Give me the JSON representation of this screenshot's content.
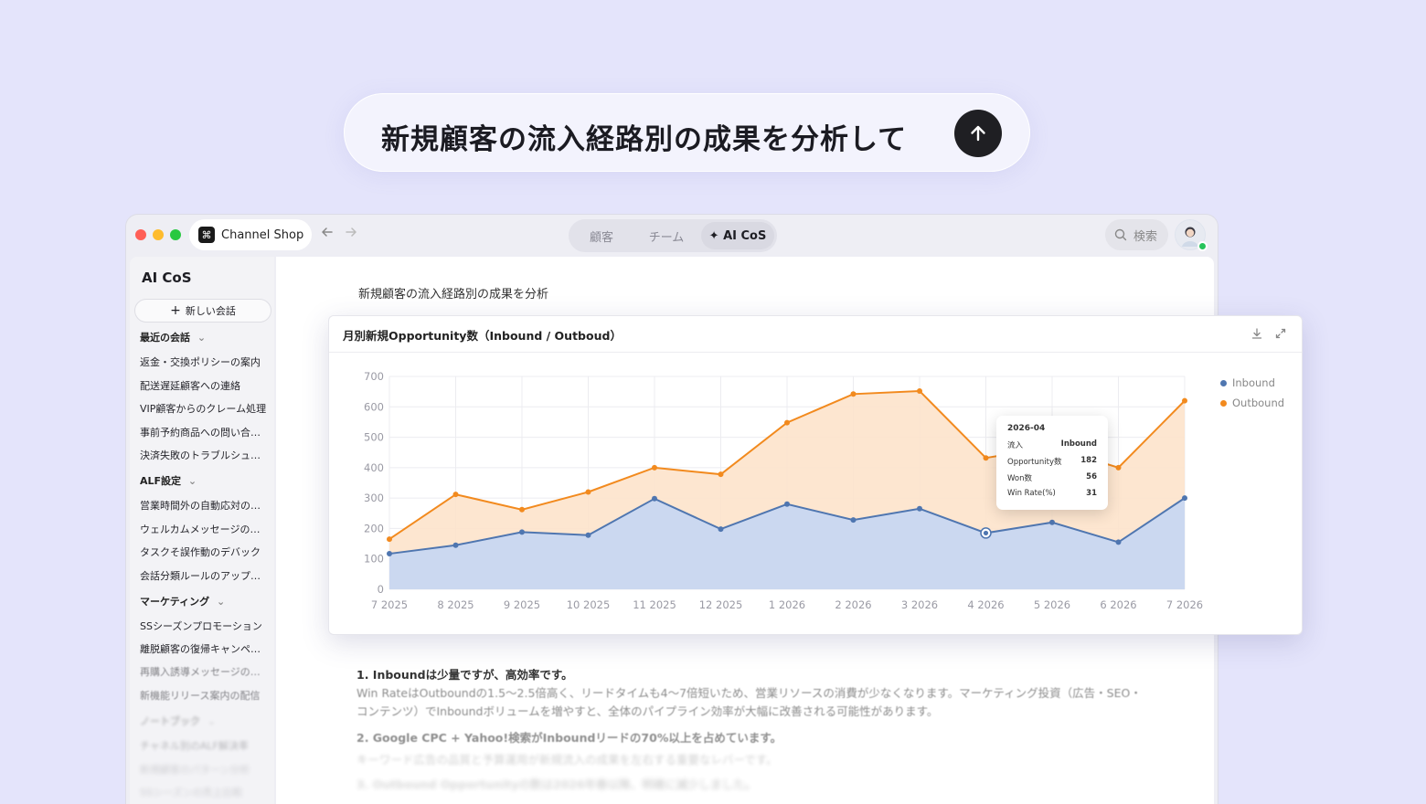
{
  "prompt": {
    "text": "新規顧客の流入経路別の成果を分析して",
    "send_icon": "arrow-up-icon"
  },
  "window": {
    "app_name": "Channel Shop",
    "tabs": [
      {
        "label": "顧客",
        "active": false
      },
      {
        "label": "チーム",
        "active": false
      },
      {
        "label": "✦ AI CoS",
        "active": true
      }
    ],
    "search_label": "検索"
  },
  "sidebar": {
    "title": "AI CoS",
    "new_chat": "新しい会話",
    "sections": [
      {
        "heading": "最近の会話",
        "items": [
          "返金・交換ポリシーの案内",
          "配送遅延顧客への連絡",
          "VIP顧客からのクレーム処理",
          "事前予約商品への問い合わせ",
          "決済失敗のトラブルシューティング"
        ]
      },
      {
        "heading": "ALF設定",
        "items": [
          "営業時間外の自動応対の設定",
          "ウェルカムメッセージの設定",
          "タスクそ誤作動のデバック",
          "会話分類ルールのアップデート"
        ]
      },
      {
        "heading": "マーケティング",
        "items": [
          "SSシーズンプロモーション",
          "離脱顧客の復帰キャンペーン",
          "再購入誘導メッセージの作成",
          "新機能リリース案内の配信"
        ]
      },
      {
        "heading": "ノートブック",
        "items": [
          "チャネル別のALF解決率",
          "新規顧客のパターン分析",
          "SSシーズンの売上比較"
        ]
      }
    ]
  },
  "main": {
    "query": "新規顧客の流入経路別の成果を分析",
    "answer": {
      "p1_head": "1. Inboundは少量ですが、高効率です。",
      "p1_body": "Win RateはOutboundの1.5〜2.5倍高く、リードタイムも4〜7倍短いため、営業リソースの消費が少なくなります。マーケティング投資（広告・SEO・コンテンツ）でInboundボリュームを増やすと、全体のパイプライン効率が大幅に改善される可能性があります。",
      "p2_head": "2. Google CPC + Yahoo!検索がInboundリードの70%以上を占めています。",
      "p2_body": "キーワード広告の品質と予算運用が新規流入の成果を左右する重要なレバーです。",
      "p3_head": "3. Outbound Opportunityの数は2026年春以降、明確に減少しました。"
    }
  },
  "chart": {
    "title": "月別新規Opportunity数（Inbound / Outboud）",
    "tools": [
      "download-icon",
      "expand-icon"
    ],
    "tooltip": {
      "date": "2026-04",
      "rows": [
        {
          "label": "流入",
          "value": "Inbound"
        },
        {
          "label": "Opportunity数",
          "value": "182"
        },
        {
          "label": "Won数",
          "value": "56"
        },
        {
          "label": "Win Rate(%)",
          "value": "31"
        }
      ]
    }
  },
  "chart_data": {
    "type": "area",
    "title": "月別新規Opportunity数（Inbound / Outboud）",
    "categories": [
      "7 2025",
      "8 2025",
      "9 2025",
      "10 2025",
      "11 2025",
      "12 2025",
      "1 2026",
      "2 2026",
      "3 2026",
      "4 2026",
      "5 2026",
      "6 2026",
      "7 2026"
    ],
    "series": [
      {
        "name": "Inbound",
        "color": "#4f76b0",
        "fill": "#c5d6f3",
        "values": [
          117,
          145,
          188,
          178,
          298,
          198,
          280,
          228,
          265,
          185,
          220,
          155,
          300
        ]
      },
      {
        "name": "Outbound",
        "color": "#f28a1e",
        "fill": "#fde3cb",
        "values": [
          165,
          312,
          262,
          320,
          400,
          378,
          548,
          642,
          652,
          432,
          468,
          400,
          620
        ]
      }
    ],
    "yticks": [
      0,
      100,
      200,
      300,
      400,
      500,
      600,
      700
    ],
    "ylim": [
      0,
      700
    ],
    "grid": true,
    "legend_position": "top-right",
    "highlight_index": 9
  }
}
